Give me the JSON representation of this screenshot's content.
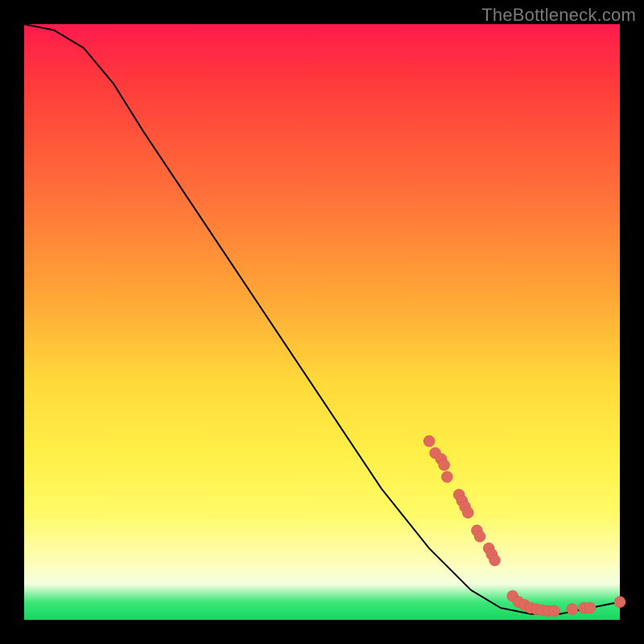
{
  "watermark": "TheBottleneck.com",
  "chart_data": {
    "type": "line",
    "title": "",
    "xlabel": "",
    "ylabel": "",
    "xlim": [
      0,
      100
    ],
    "ylim": [
      0,
      100
    ],
    "curve": [
      {
        "x": 0,
        "y": 100
      },
      {
        "x": 5,
        "y": 99
      },
      {
        "x": 10,
        "y": 96
      },
      {
        "x": 15,
        "y": 90
      },
      {
        "x": 20,
        "y": 82
      },
      {
        "x": 30,
        "y": 67
      },
      {
        "x": 40,
        "y": 52
      },
      {
        "x": 50,
        "y": 37
      },
      {
        "x": 60,
        "y": 22
      },
      {
        "x": 68,
        "y": 12
      },
      {
        "x": 75,
        "y": 5
      },
      {
        "x": 80,
        "y": 2
      },
      {
        "x": 85,
        "y": 1
      },
      {
        "x": 90,
        "y": 1
      },
      {
        "x": 95,
        "y": 2
      },
      {
        "x": 100,
        "y": 3
      }
    ],
    "data_points": [
      {
        "x": 68,
        "y": 30
      },
      {
        "x": 69,
        "y": 28
      },
      {
        "x": 70,
        "y": 27
      },
      {
        "x": 70.5,
        "y": 26
      },
      {
        "x": 71,
        "y": 24
      },
      {
        "x": 73,
        "y": 21
      },
      {
        "x": 73.5,
        "y": 20
      },
      {
        "x": 74,
        "y": 19
      },
      {
        "x": 74.5,
        "y": 18
      },
      {
        "x": 76,
        "y": 15
      },
      {
        "x": 76.5,
        "y": 14
      },
      {
        "x": 78,
        "y": 12
      },
      {
        "x": 78.5,
        "y": 11
      },
      {
        "x": 79,
        "y": 10
      },
      {
        "x": 82,
        "y": 4
      },
      {
        "x": 83,
        "y": 3
      },
      {
        "x": 84,
        "y": 2.5
      },
      {
        "x": 85,
        "y": 2
      },
      {
        "x": 86,
        "y": 1.8
      },
      {
        "x": 87,
        "y": 1.6
      },
      {
        "x": 88,
        "y": 1.5
      },
      {
        "x": 89,
        "y": 1.5
      },
      {
        "x": 92,
        "y": 1.8
      },
      {
        "x": 94,
        "y": 2
      },
      {
        "x": 95,
        "y": 2
      },
      {
        "x": 100,
        "y": 3
      }
    ]
  }
}
